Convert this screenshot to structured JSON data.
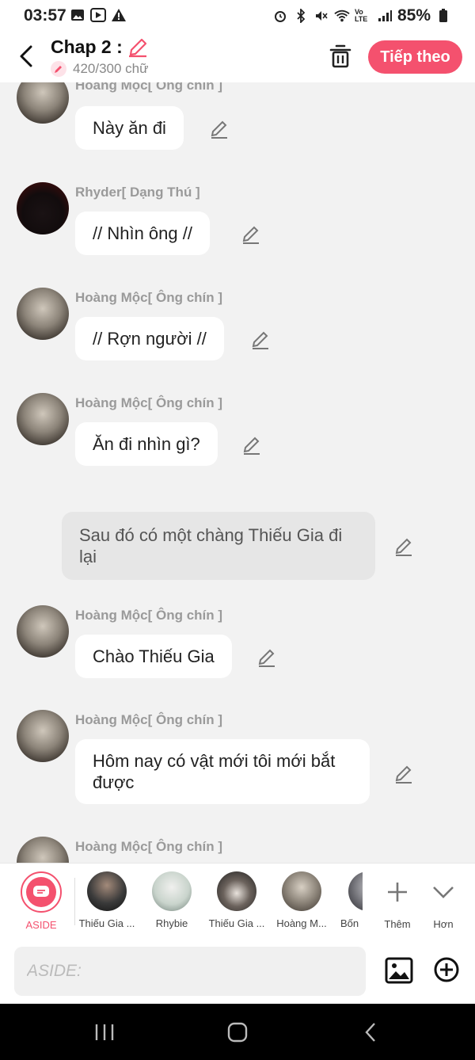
{
  "status": {
    "time": "03:57",
    "battery": "85%"
  },
  "header": {
    "title": "Chap 2 :",
    "word_count": "420/300 chữ",
    "next_label": "Tiếp theo"
  },
  "messages": [
    {
      "speaker": "Hoàng Mộc[ Ông chín ]",
      "text": "Này ăn đi"
    },
    {
      "speaker": "Rhyder[ Dạng Thú ]",
      "text": "// Nhìn ông //"
    },
    {
      "speaker": "Hoàng Mộc[ Ông chín ]",
      "text": "// Rợn người //"
    },
    {
      "speaker": "Hoàng Mộc[ Ông chín ]",
      "text": "Ăn đi nhìn gì?"
    },
    {
      "narration": "Sau đó có một chàng Thiếu Gia đi lại"
    },
    {
      "speaker": "Hoàng Mộc[ Ông chín ]",
      "text": "Chào Thiếu Gia"
    },
    {
      "speaker": "Hoàng Mộc[ Ông chín ]",
      "text": "Hôm nay có vật mới tôi mới bắt được"
    },
    {
      "speaker": "Hoàng Mộc[ Ông chín ]",
      "text": ""
    }
  ],
  "characters": [
    {
      "label": "ASIDE",
      "color": "#f4516e"
    },
    {
      "label": "Thiếu Gia ...",
      "color": "#3a3a3a"
    },
    {
      "label": "Rhybie",
      "color": "#c9d4cc"
    },
    {
      "label": "Thiếu Gia ...",
      "color": "#2a2a2a"
    },
    {
      "label": "Hoàng M...",
      "color": "#8c8479"
    },
    {
      "label": "Bốn",
      "color": "#6a6a70"
    }
  ],
  "char_actions": {
    "more_label": "Thêm",
    "less_label": "Hơn"
  },
  "input": {
    "placeholder": "ASIDE:"
  },
  "colors": {
    "accent": "#f4516e",
    "background": "#f2f2f2"
  }
}
